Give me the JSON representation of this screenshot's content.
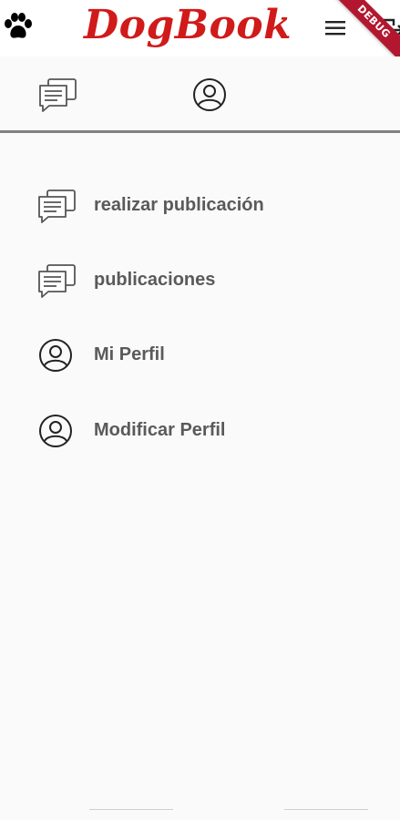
{
  "app": {
    "title": "DogBook",
    "debug_banner": "DEBUG",
    "brand_color": "#d11a1a"
  },
  "appbar": {
    "left_icon": "paw-icon",
    "menu_icon": "menu-icon",
    "exit_icon": "exit-icon"
  },
  "tabs": [
    {
      "icon": "chat-icon"
    },
    {
      "icon": "profile-icon"
    }
  ],
  "drawer": {
    "items": [
      {
        "label": "realizar publicación",
        "icon": "chat-icon"
      },
      {
        "label": "publicaciones",
        "icon": "chat-icon"
      },
      {
        "label": "Mi Perfil",
        "icon": "profile-icon"
      },
      {
        "label": "Modificar Perfil",
        "icon": "profile-icon"
      }
    ]
  }
}
